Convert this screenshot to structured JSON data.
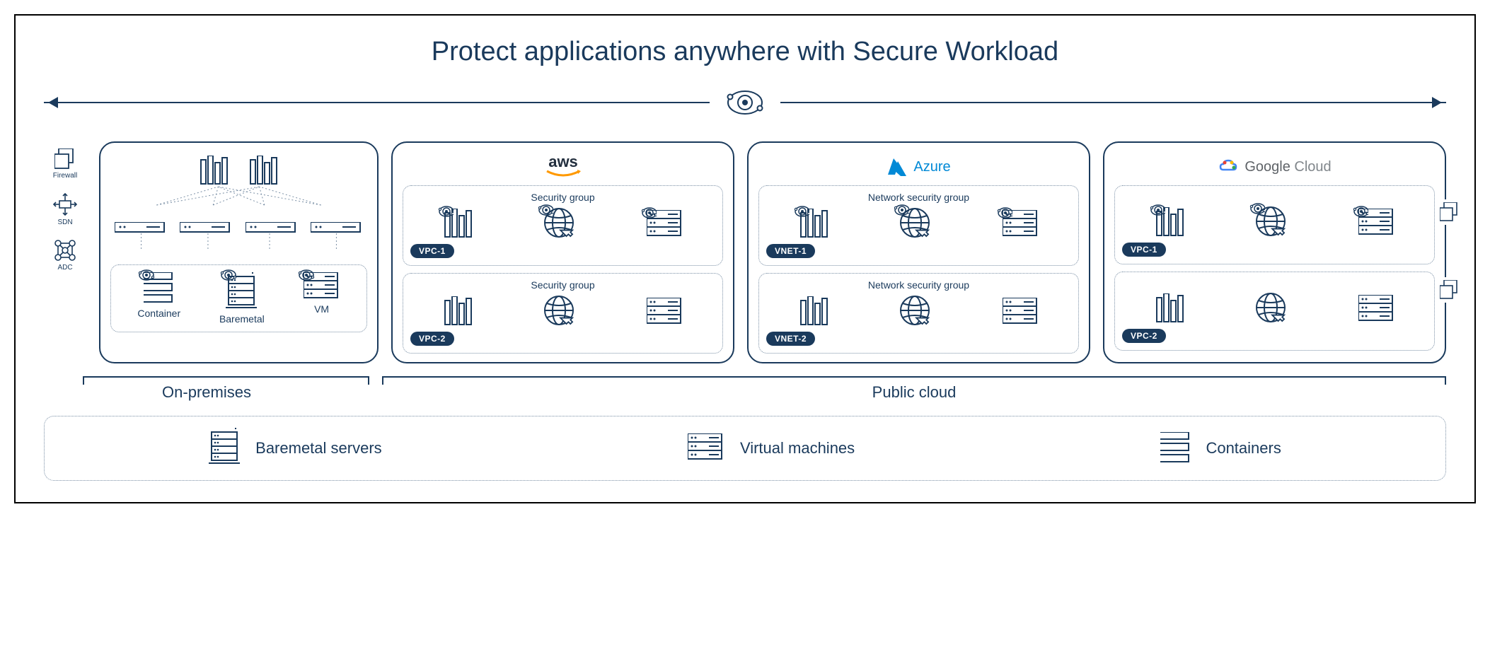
{
  "title": "Protect applications anywhere with Secure Workload",
  "side": {
    "firewall": "Firewall",
    "sdn": "SDN",
    "adc": "ADC"
  },
  "onprem": {
    "items": {
      "container": "Container",
      "baremetal": "Baremetal",
      "vm": "VM"
    }
  },
  "clouds": {
    "aws": {
      "name": "aws",
      "group_label": "Security group",
      "net1": "VPC-1",
      "net2": "VPC-2"
    },
    "azure": {
      "name": "Azure",
      "group_label": "Network security group",
      "net1": "VNET-1",
      "net2": "VNET-2"
    },
    "gcp": {
      "name_a": "Google",
      "name_b": "Cloud",
      "net1": "VPC-1",
      "net2": "VPC-2"
    }
  },
  "sections": {
    "onprem": "On-premises",
    "public": "Public cloud"
  },
  "legend": {
    "baremetal": "Baremetal servers",
    "vm": "Virtual machines",
    "containers": "Containers"
  }
}
